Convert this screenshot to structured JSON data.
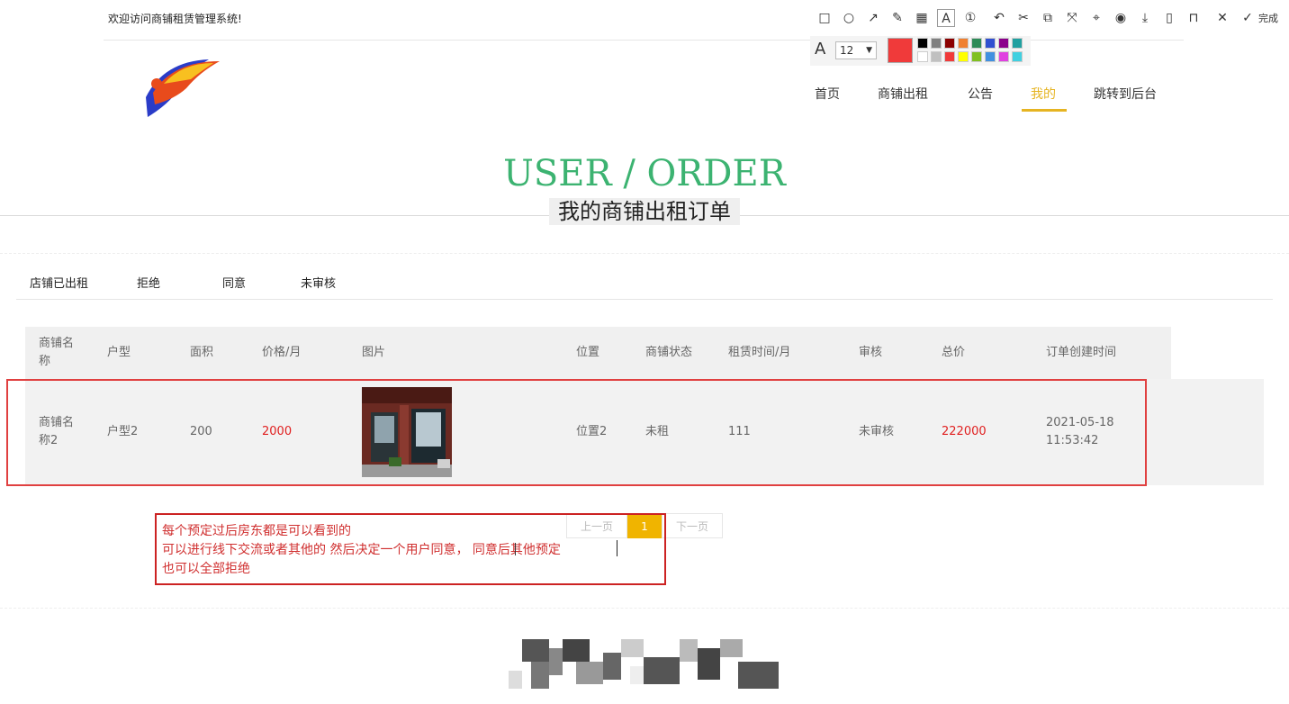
{
  "header": {
    "welcome": "欢迎访问商铺租赁管理系统!",
    "nav": [
      "首页",
      "商铺出租",
      "公告",
      "我的",
      "跳转到后台"
    ]
  },
  "hero": {
    "en": "USER / ORDER",
    "cn": "我的商铺出租订单"
  },
  "tabs": [
    "店铺已出租",
    "拒绝",
    "同意",
    "未审核"
  ],
  "table": {
    "headers": [
      "商铺名称",
      "户型",
      "面积",
      "价格/月",
      "图片",
      "位置",
      "商铺状态",
      "租赁时间/月",
      "审核",
      "总价",
      "订单创建时间"
    ],
    "rows": [
      {
        "name": "商铺名称2",
        "type": "户型2",
        "area": "200",
        "price": "2000",
        "location": "位置2",
        "status": "未租",
        "months": "111",
        "review": "未审核",
        "total": "222000",
        "created_date": "2021-05-18",
        "created_time": "11:53:42"
      }
    ]
  },
  "pager": {
    "prev": "上一页",
    "current": "1",
    "next": "下一页"
  },
  "annotation": {
    "lines": [
      "每个预定过后房东都是可以看到的",
      "可以进行线下交流或者其他的 然后决定一个用户同意， 同意后其他预定",
      "也可以全部拒绝"
    ]
  },
  "screenshot_tool": {
    "done_label": "完成",
    "font_size": "12",
    "current_color": "#f03a3a",
    "palette": [
      "#000000",
      "#808080",
      "#8b0000",
      "#f08030",
      "#2e8b57",
      "#3050d0",
      "#8b008b",
      "#20a0a0",
      "#ffffff",
      "#c0c0c0",
      "#f03a3a",
      "#ffff00",
      "#80c020",
      "#4090e0",
      "#e040e0",
      "#40d0e0"
    ]
  },
  "colors": {
    "accent": "#e6b422",
    "hero": "#3cb371",
    "price_red": "#e02020"
  }
}
